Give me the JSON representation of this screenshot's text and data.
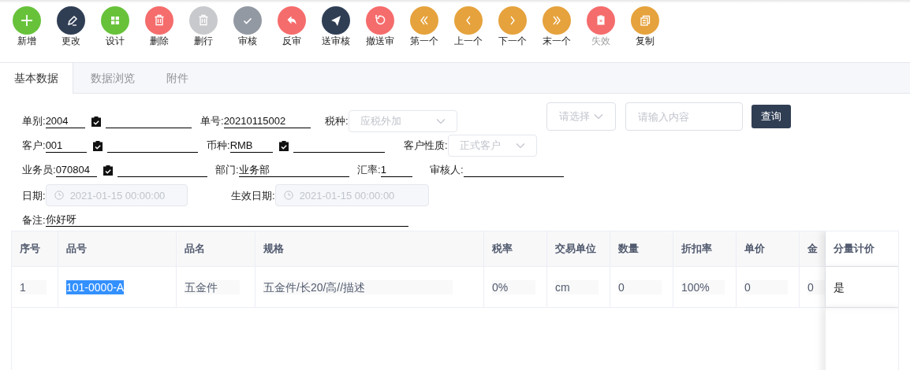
{
  "toolbar": [
    {
      "label": "新增",
      "kind": "plus",
      "color": "#67c23a",
      "disabled": false
    },
    {
      "label": "更改",
      "kind": "pencil",
      "color": "#303e54",
      "disabled": false
    },
    {
      "label": "设计",
      "kind": "grid",
      "color": "#67c23a",
      "disabled": false
    },
    {
      "label": "删除",
      "kind": "trash",
      "color": "#f56c6c",
      "disabled": false
    },
    {
      "label": "删行",
      "kind": "trash",
      "color": "#c8c9cc",
      "disabled": false
    },
    {
      "label": "审核",
      "kind": "check",
      "color": "#9399a2",
      "disabled": false
    },
    {
      "label": "反审",
      "kind": "reply",
      "color": "#f56c6c",
      "disabled": false
    },
    {
      "label": "送审核",
      "kind": "plane",
      "color": "#303e54",
      "disabled": false
    },
    {
      "label": "撤送审",
      "kind": "refresh",
      "color": "#f56c6c",
      "disabled": false
    },
    {
      "label": "第一个",
      "kind": "first",
      "color": "#e6a23c",
      "disabled": false
    },
    {
      "label": "上一个",
      "kind": "prev",
      "color": "#e6a23c",
      "disabled": false
    },
    {
      "label": "下一个",
      "kind": "next",
      "color": "#e6a23c",
      "disabled": false
    },
    {
      "label": "末一个",
      "kind": "last",
      "color": "#e6a23c",
      "disabled": false
    },
    {
      "label": "失效",
      "kind": "clipboard",
      "color": "#f56c6c",
      "disabled": true
    },
    {
      "label": "复制",
      "kind": "copy",
      "color": "#e6a23c",
      "disabled": false
    }
  ],
  "tabs": [
    {
      "label": "基本数据",
      "selected": true
    },
    {
      "label": "数据浏览",
      "selected": false
    },
    {
      "label": "附件",
      "selected": false
    }
  ],
  "form": {
    "fields": [
      {
        "kind": "lookup",
        "label": "单别:",
        "value": "2004",
        "disabled": false
      },
      {
        "kind": "text",
        "label": "单号:",
        "value": "20210115002",
        "disabled": false
      },
      {
        "kind": "select",
        "label": "税种:",
        "value": "应税外加",
        "disabled": true
      },
      {
        "kind": "lookup",
        "label": "客户:",
        "value": "001",
        "disabled": false
      },
      {
        "kind": "lookup",
        "label": "币种:",
        "value": "RMB",
        "disabled": false
      },
      {
        "kind": "select",
        "label": "客户性质:",
        "value": "正式客户",
        "disabled": true
      },
      {
        "kind": "lookup",
        "label": "业务员:",
        "value": "070804",
        "disabled": false
      },
      {
        "kind": "text",
        "label": "部门:",
        "value": "业务部",
        "disabled": false
      },
      {
        "kind": "text",
        "label": "汇率:",
        "value": "1",
        "disabled": false
      },
      {
        "kind": "text",
        "label": "审核人:",
        "disabled": false
      },
      {
        "kind": "date",
        "label": "日期:",
        "value": "2021-01-15 00:00:00",
        "disabled": true
      },
      {
        "kind": "date",
        "label": "生效日期:",
        "value": "2021-01-15 00:00:00",
        "disabled": true
      },
      {
        "kind": "text",
        "label": "备注:",
        "value": "你好呀",
        "disabled": false
      }
    ]
  },
  "search": {
    "select_placeholder": "请选择",
    "input_placeholder": "请输入内容",
    "button": "查询"
  },
  "table": {
    "columns": [
      "序号",
      "品号",
      "品名",
      "规格",
      "税率",
      "交易单位",
      "数量",
      "折扣率",
      "单价",
      "金",
      "分量计价"
    ],
    "rows": [
      {
        "cells": [
          {
            "text": "1",
            "selected": false
          },
          {
            "text": "101-0000-A",
            "selected": true
          },
          {
            "text": "五金件",
            "selected": false
          },
          {
            "text": "五金件/长20/高//描述",
            "selected": false
          },
          {
            "text": "0%",
            "selected": false
          },
          {
            "text": "cm",
            "selected": false
          },
          {
            "text": "0",
            "selected": false
          },
          {
            "text": "100%",
            "selected": false
          },
          {
            "text": "0",
            "selected": false
          },
          {
            "text": "0",
            "selected": false
          },
          {
            "text": "是",
            "selected": false
          }
        ]
      }
    ]
  }
}
